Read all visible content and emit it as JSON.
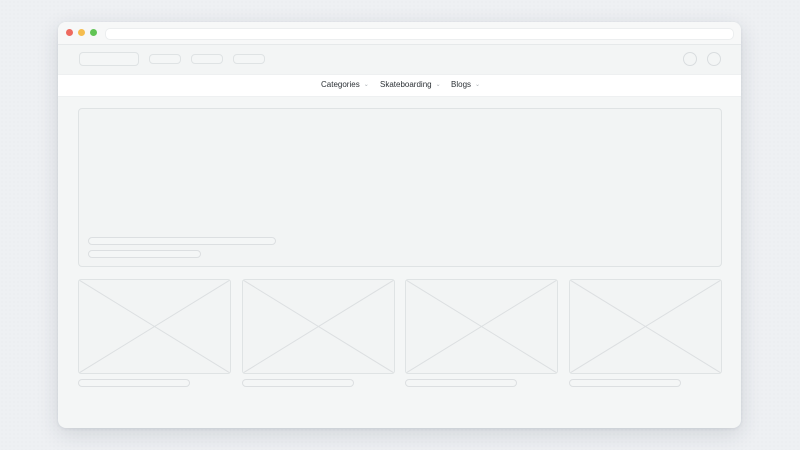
{
  "colors": {
    "close": "#ee6a5f",
    "minimize": "#f5bd4f",
    "maximize": "#61c454"
  },
  "window_controls": [
    "close-icon",
    "minimize-icon",
    "maximize-icon"
  ],
  "nav": {
    "items": [
      {
        "label": "Categories",
        "icon": "chevron-down-icon"
      },
      {
        "label": "Skateboarding",
        "icon": "chevron-down-icon"
      },
      {
        "label": "Blogs",
        "icon": "chevron-down-icon"
      }
    ],
    "chevron": "⌄"
  }
}
